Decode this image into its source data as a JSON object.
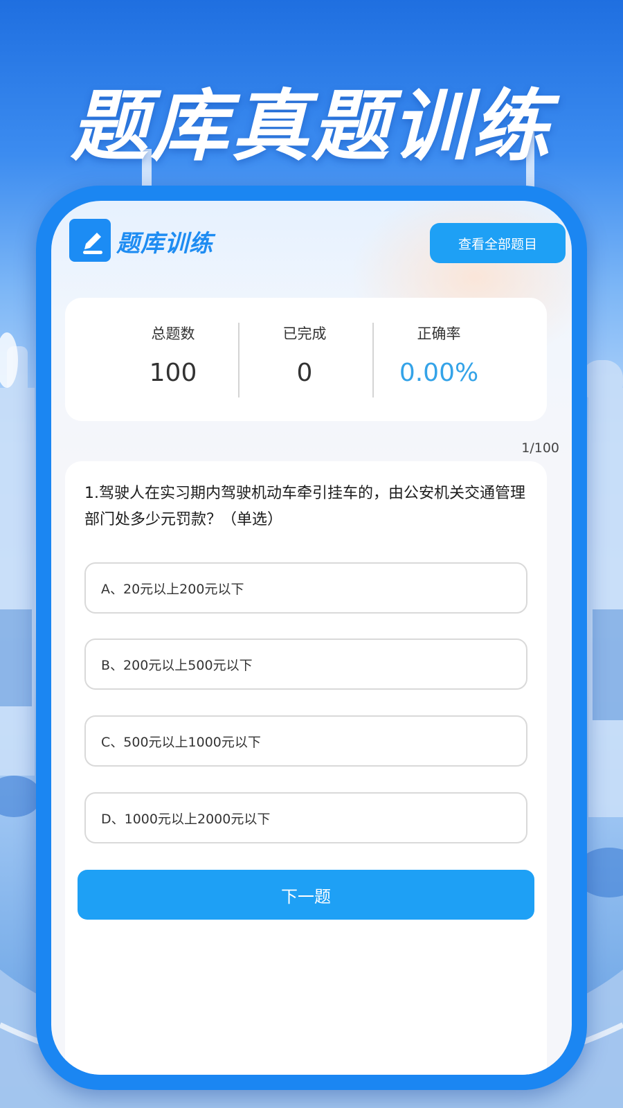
{
  "promo": {
    "title": "题库真题训练"
  },
  "app": {
    "title": "题库训练",
    "view_all_label": "查看全部题目"
  },
  "stats": [
    {
      "label": "总题数",
      "value": "100"
    },
    {
      "label": "已完成",
      "value": "0"
    },
    {
      "label": "正确率",
      "value": "0.00%"
    }
  ],
  "progress": "1/100",
  "question": {
    "text": "1.驾驶人在实习期内驾驶机动车牵引挂车的，由公安机关交通管理部门处多少元罚款？（单选）",
    "options": [
      "A、20元以上200元以下",
      "B、200元以上500元以下",
      "C、500元以上1000元以下",
      "D、1000元以上2000元以下"
    ]
  },
  "next_label": "下一题",
  "colors": {
    "accent": "#1ea0f5",
    "frame": "#1b86f2",
    "rate": "#34a3e8"
  },
  "icons": {
    "logo": "pencil-note-icon"
  }
}
